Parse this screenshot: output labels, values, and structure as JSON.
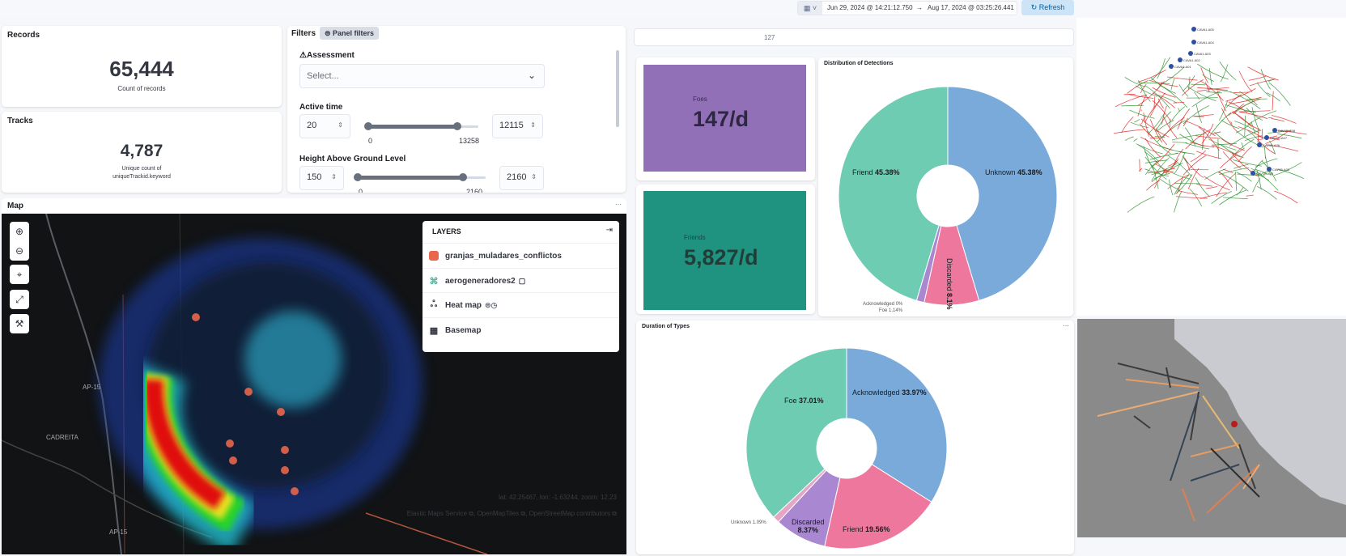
{
  "topbar": {
    "date_start": "Jun 29, 2024 @ 14:21:12.750",
    "arrow": "→",
    "date_end": "Aug 17, 2024 @ 03:25:26.441",
    "refresh_label": "Refresh",
    "timeline_value": "127"
  },
  "records": {
    "title": "Records",
    "value": "65,444",
    "subtitle": "Count of records"
  },
  "tracks": {
    "title": "Tracks",
    "value": "4,787",
    "subtitle_line1": "Unique count of",
    "subtitle_line2": "uniqueTrackid.keyword"
  },
  "filters": {
    "title": "Filters",
    "panel_filters_label": "Panel filters",
    "assessment": {
      "label": "Assessment",
      "placeholder": "Select..."
    },
    "active_time": {
      "label": "Active time",
      "min_value": "20",
      "max_value": "12115",
      "range_min": "0",
      "range_max": "13258",
      "lower_fraction": 0.0015,
      "upper_fraction": 0.914
    },
    "height_agl": {
      "label": "Height Above Ground Level",
      "min_value": "150",
      "max_value": "2160",
      "range_min": "0",
      "range_max": "2160",
      "lower_fraction": 0.069,
      "upper_fraction": 1.0
    }
  },
  "map": {
    "title": "Map",
    "layers_title": "LAYERS",
    "layers": [
      {
        "name": "granjas_muladares_conflictos",
        "icon": "square-swatch-icon",
        "color": "#e7664c"
      },
      {
        "name": "aerogeneradores2",
        "icon": "wind-turbine-icon",
        "color": "#54b399"
      },
      {
        "name": "Heat map",
        "icon": "heatmap-icon"
      },
      {
        "name": "Basemap",
        "icon": "grid-icon"
      }
    ],
    "place_labels": [
      "CADREITA",
      "AP-15",
      "AP-15"
    ],
    "coords": "lat: 42.25467, lon: -1.63244, zoom: 12.23",
    "attribution": [
      "Elastic Maps Service",
      "OpenMapTiles",
      "OpenStreetMap contributors"
    ]
  },
  "foes": {
    "label": "Foes",
    "value": "147/d",
    "color": "#9170b8"
  },
  "friends": {
    "label": "Friends",
    "value": "5,827/d",
    "color": "#209280"
  },
  "chart_data": [
    {
      "type": "pie",
      "title": "Distribution of Detections",
      "donut": true,
      "slices": [
        {
          "label": "Unknown",
          "value": 45.38,
          "color": "#79aad9"
        },
        {
          "label": "Discarded",
          "value": 8.1,
          "color": "#ee789d"
        },
        {
          "label": "Foe",
          "value": 1.14,
          "color": "#a987d1"
        },
        {
          "label": "Acknowledged",
          "value": 0,
          "color": "#e4a6c7"
        },
        {
          "label": "Friend",
          "value": 45.38,
          "color": "#6dccb1"
        }
      ]
    },
    {
      "type": "pie",
      "title": "Duration of Types",
      "donut": true,
      "slices": [
        {
          "label": "Acknowledged",
          "value": 33.97,
          "color": "#79aad9"
        },
        {
          "label": "Friend",
          "value": 19.56,
          "color": "#ee789d"
        },
        {
          "label": "Discarded",
          "value": 8.37,
          "color": "#a987d1"
        },
        {
          "label": "Unknown",
          "value": 1.09,
          "color": "#e4a6c7"
        },
        {
          "label": "Foe",
          "value": 37.01,
          "color": "#6dccb1"
        }
      ]
    }
  ],
  "network_labels": [
    "CAVA1.A05",
    "CAVA1.A04",
    "CAVA1.A03",
    "CAVA1.A02",
    "CAVA1.A01",
    "CAV1B.A08",
    "CAV1B.A07",
    "CAV1B.A06",
    "CAV1B.A03",
    "CAV1B.A05"
  ]
}
